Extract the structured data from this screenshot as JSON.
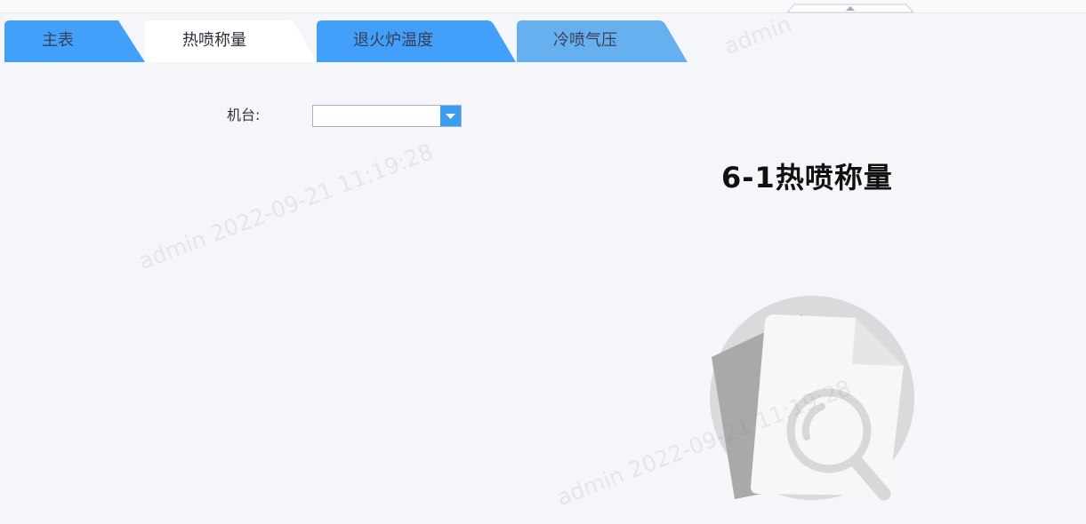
{
  "tabs": [
    {
      "label": "主表",
      "active": false,
      "color": "#42a0fa"
    },
    {
      "label": "热喷称量",
      "active": true,
      "color": "#ffffff"
    },
    {
      "label": "退火炉温度",
      "active": false,
      "color": "#42a0fa"
    },
    {
      "label": "冷喷气压",
      "active": false,
      "color": "#66b0f0"
    }
  ],
  "filter": {
    "machine_label": "机台:",
    "machine_value": ""
  },
  "report": {
    "title": "6-1热喷称量"
  },
  "empty_state": {
    "icon": "no-data-search-icon"
  },
  "watermark": {
    "text": "admin 2022-09-21 11:19:28",
    "partial_text": "admin"
  },
  "colors": {
    "accent": "#3b9df0",
    "tab_blue": "#42a0fa",
    "tab_light_blue": "#66b0f0",
    "page_bg": "#f5f6f9"
  }
}
